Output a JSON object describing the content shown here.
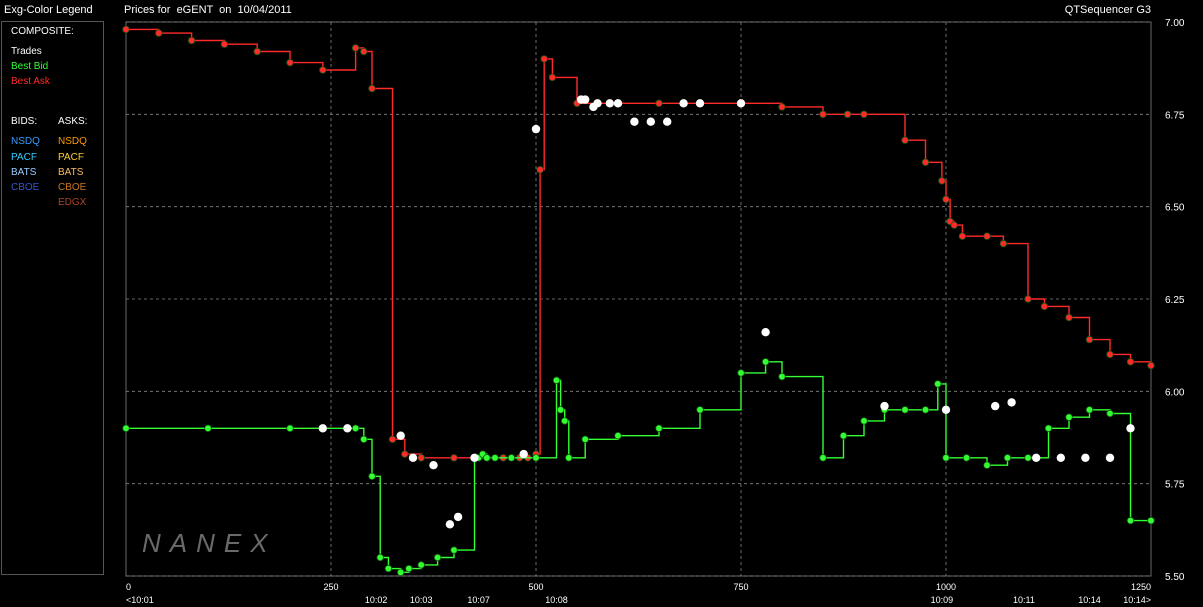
{
  "legend": {
    "title": "Exg-Color Legend",
    "composite_heading": "COMPOSITE:",
    "composite": [
      {
        "label": "Trades",
        "color": "#ffffff"
      },
      {
        "label": "Best Bid",
        "color": "#33ff33"
      },
      {
        "label": "Best Ask",
        "color": "#ff2a2a"
      }
    ],
    "bids_heading": "BIDS:",
    "asks_heading": "ASKS:",
    "bids": [
      {
        "label": "NSDQ",
        "color": "#3399ff"
      },
      {
        "label": "PACF",
        "color": "#33ccff"
      },
      {
        "label": "BATS",
        "color": "#99ccff"
      },
      {
        "label": "CBOE",
        "color": "#3355cc"
      }
    ],
    "asks": [
      {
        "label": "NSDQ",
        "color": "#ff9900"
      },
      {
        "label": "PACF",
        "color": "#ffcc33"
      },
      {
        "label": "BATS",
        "color": "#ffbb66"
      },
      {
        "label": "CBOE",
        "color": "#cc7722"
      },
      {
        "label": "EDGX",
        "color": "#aa4422"
      }
    ]
  },
  "header": {
    "chart_title": "Prices for  eGENT  on  10/04/2011",
    "app_title": "QTSequencer G3"
  },
  "watermark": "NANEX",
  "chart_data": {
    "type": "line",
    "title": "Prices for  eGENT  on  10/04/2011",
    "ylim": [
      5.5,
      7.0
    ],
    "y_ticks": [
      "7.00",
      "6.75",
      "6.50",
      "6.25",
      "6.00",
      "5.75",
      "5.50"
    ],
    "xlim": [
      0,
      1250
    ],
    "x_ticks": [
      {
        "value": 0,
        "label": "0"
      },
      {
        "value": 250,
        "label": "250"
      },
      {
        "value": 500,
        "label": "500"
      },
      {
        "value": 750,
        "label": "750"
      },
      {
        "value": 1000,
        "label": "1000"
      },
      {
        "value": 1250,
        "label": "1250"
      }
    ],
    "time_labels": [
      {
        "x": 0,
        "label": "<10:01"
      },
      {
        "x": 305,
        "label": "10:02"
      },
      {
        "x": 360,
        "label": "10:03"
      },
      {
        "x": 430,
        "label": "10:07"
      },
      {
        "x": 525,
        "label": "10:08"
      },
      {
        "x": 995,
        "label": "10:09"
      },
      {
        "x": 1095,
        "label": "10:11"
      },
      {
        "x": 1175,
        "label": "10:14"
      },
      {
        "x": 1250,
        "label": "10:14>"
      }
    ],
    "grid": true,
    "series": [
      {
        "name": "Best Ask",
        "color": "#ff2a2a",
        "x": [
          0,
          40,
          80,
          120,
          160,
          200,
          240,
          280,
          290,
          300,
          325,
          340,
          360,
          400,
          440,
          460,
          470,
          480,
          490,
          500,
          505,
          510,
          520,
          550,
          600,
          650,
          700,
          750,
          800,
          850,
          880,
          900,
          950,
          975,
          995,
          1000,
          1005,
          1010,
          1020,
          1050,
          1070,
          1100,
          1120,
          1150,
          1175,
          1200,
          1225,
          1250
        ],
        "y": [
          6.98,
          6.97,
          6.95,
          6.94,
          6.92,
          6.89,
          6.87,
          6.93,
          6.92,
          6.82,
          5.87,
          5.83,
          5.82,
          5.82,
          5.82,
          5.82,
          5.82,
          5.82,
          5.82,
          5.83,
          6.6,
          6.9,
          6.85,
          6.78,
          6.78,
          6.78,
          6.78,
          6.78,
          6.77,
          6.75,
          6.75,
          6.75,
          6.68,
          6.62,
          6.57,
          6.52,
          6.46,
          6.45,
          6.42,
          6.42,
          6.4,
          6.25,
          6.23,
          6.2,
          6.14,
          6.1,
          6.08,
          6.07
        ]
      },
      {
        "name": "Best Bid",
        "color": "#33ff33",
        "x": [
          0,
          100,
          200,
          240,
          280,
          290,
          300,
          310,
          320,
          335,
          345,
          360,
          380,
          400,
          425,
          430,
          435,
          440,
          450,
          470,
          500,
          525,
          530,
          535,
          540,
          560,
          600,
          650,
          700,
          750,
          780,
          800,
          850,
          875,
          900,
          925,
          950,
          975,
          990,
          1000,
          1025,
          1050,
          1075,
          1100,
          1125,
          1150,
          1175,
          1200,
          1225,
          1250
        ],
        "y": [
          5.9,
          5.9,
          5.9,
          5.9,
          5.9,
          5.87,
          5.77,
          5.55,
          5.52,
          5.51,
          5.52,
          5.53,
          5.55,
          5.57,
          5.82,
          5.82,
          5.83,
          5.82,
          5.82,
          5.82,
          5.82,
          6.03,
          5.95,
          5.92,
          5.82,
          5.87,
          5.88,
          5.9,
          5.95,
          6.05,
          6.08,
          6.04,
          5.82,
          5.88,
          5.92,
          5.95,
          5.95,
          5.95,
          6.02,
          5.82,
          5.82,
          5.8,
          5.82,
          5.82,
          5.9,
          5.93,
          5.95,
          5.94,
          5.65,
          5.65
        ]
      },
      {
        "name": "Trades",
        "color": "#ffffff",
        "x": [
          240,
          270,
          335,
          350,
          375,
          395,
          405,
          425,
          485,
          500,
          555,
          560,
          570,
          575,
          590,
          600,
          620,
          640,
          660,
          680,
          700,
          750,
          780,
          925,
          1000,
          1060,
          1080,
          1110,
          1140,
          1170,
          1200,
          1225
        ],
        "y": [
          5.9,
          5.9,
          5.88,
          5.82,
          5.8,
          5.64,
          5.66,
          5.82,
          5.83,
          6.71,
          6.79,
          6.79,
          6.77,
          6.78,
          6.78,
          6.78,
          6.73,
          6.73,
          6.73,
          6.78,
          6.78,
          6.78,
          6.16,
          5.96,
          5.95,
          5.96,
          5.97,
          5.82,
          5.82,
          5.82,
          5.82,
          5.9
        ]
      }
    ]
  }
}
